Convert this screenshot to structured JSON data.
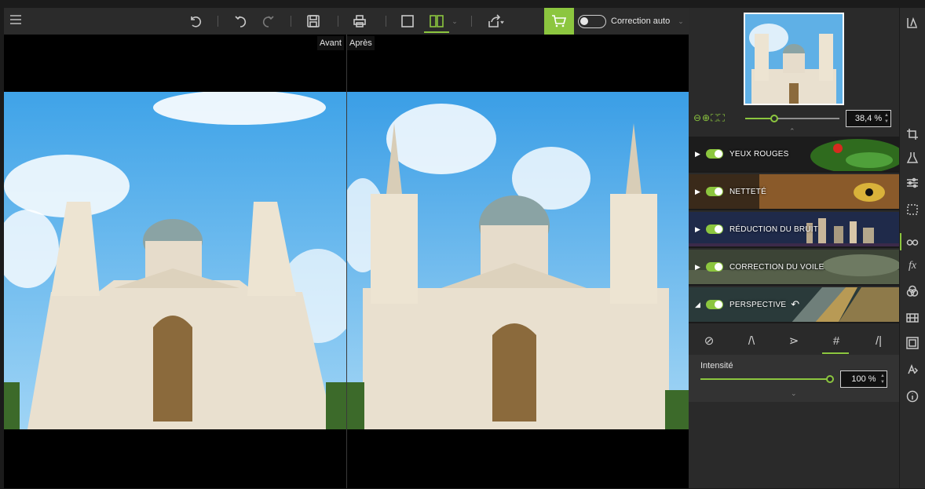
{
  "toolbar": {
    "auto_correction_label": "Correction auto",
    "tooltip_before": "Avant",
    "tooltip_after": "Après"
  },
  "panel": {
    "zoom_value": "38,4 %",
    "modules": [
      {
        "label": "YEUX ROUGES",
        "expanded": false
      },
      {
        "label": "NETTETÉ",
        "expanded": false
      },
      {
        "label": "RÉDUCTION DU BRUIT",
        "expanded": false
      },
      {
        "label": "CORRECTION DU VOILE",
        "expanded": false
      },
      {
        "label": "PERSPECTIVE",
        "expanded": true
      }
    ],
    "intensity_label": "Intensité",
    "intensity_value": "100 %"
  },
  "colors": {
    "accent": "#8cc63f",
    "panel_bg": "#2a2a2a",
    "toolbar_bg": "#2b2b2b"
  },
  "icons": {
    "menu": "hamburger-icon",
    "undo": "undo-icon",
    "redo": "redo-icon",
    "save": "save-icon",
    "print": "print-icon",
    "single_view": "single-view-icon",
    "split_view": "split-view-icon",
    "export": "export-icon",
    "cart": "cart-icon"
  }
}
